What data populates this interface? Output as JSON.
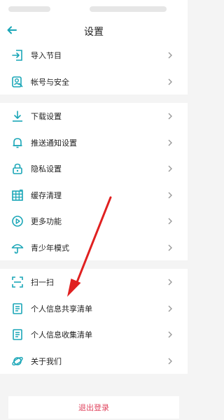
{
  "header": {
    "title": "设置"
  },
  "groups": [
    {
      "items": [
        {
          "label": "导入节目",
          "icon": "import-icon"
        },
        {
          "label": "帐号与安全",
          "icon": "account-security-icon"
        }
      ]
    },
    {
      "items": [
        {
          "label": "下载设置",
          "icon": "download-icon"
        },
        {
          "label": "推送通知设置",
          "icon": "bell-icon"
        },
        {
          "label": "隐私设置",
          "icon": "lock-icon"
        },
        {
          "label": "缓存清理",
          "icon": "grid-icon"
        },
        {
          "label": "更多功能",
          "icon": "play-circle-icon"
        },
        {
          "label": "青少年模式",
          "icon": "umbrella-icon"
        }
      ]
    },
    {
      "items": [
        {
          "label": "扫一扫",
          "icon": "scan-icon"
        },
        {
          "label": "个人信息共享清单",
          "icon": "document-icon"
        },
        {
          "label": "个人信息收集清单",
          "icon": "document-icon"
        },
        {
          "label": "关于我们",
          "icon": "planet-icon"
        }
      ]
    }
  ],
  "logout": {
    "label": "退出登录"
  },
  "colors": {
    "accent": "#1aa6b7",
    "logout_text": "#e0455f",
    "annotation_arrow": "#e02020"
  }
}
